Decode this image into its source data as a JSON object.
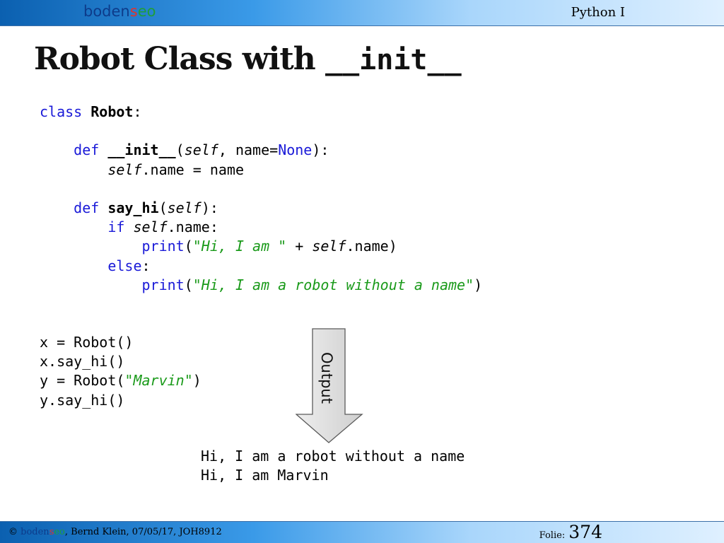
{
  "header": {
    "brand": {
      "part1": "boden",
      "part2": "s",
      "part3": "eo"
    },
    "course": "Python I"
  },
  "slide": {
    "title": {
      "text": "Robot Class with",
      "code": "__init__"
    }
  },
  "code": {
    "line1": {
      "kw": "class",
      "name": "Robot",
      "punct": ":"
    },
    "line3": {
      "kw": "def",
      "name": "__init__",
      "p1": "(",
      "self": "self",
      "rest": ", name=",
      "none": "None",
      "end": "):"
    },
    "line4": {
      "self": "self",
      "rest": ".name = name"
    },
    "line6": {
      "kw": "def",
      "name": "say_hi",
      "p1": "(",
      "self": "self",
      "end": "):"
    },
    "line7": {
      "kw": "if",
      "self": "self",
      "rest": ".name:"
    },
    "line8": {
      "kw": "print",
      "p1": "(",
      "str": "\"Hi, I am \"",
      "mid": " + ",
      "self": "self",
      "end": ".name)"
    },
    "line9": {
      "kw": "else",
      "punct": ":"
    },
    "line10": {
      "kw": "print",
      "p1": "(",
      "str": "\"Hi, I am a robot without a name\"",
      "end": ")"
    }
  },
  "usage": {
    "line1": "x = Robot()",
    "line2": "x.say_hi()",
    "line3a": "y = Robot(",
    "line3str": "\"Marvin\"",
    "line3b": ")",
    "line4": "y.say_hi()"
  },
  "arrow": {
    "label": "Output"
  },
  "output": {
    "line1": "Hi, I am a robot without a name",
    "line2": "Hi, I am Marvin"
  },
  "footer": {
    "copyright": "©",
    "brand": {
      "part1": "boden",
      "part2": "s",
      "part3": "eo"
    },
    "info": ", Bernd Klein, 07/05/17, JOH8912",
    "folie_label": "Folie:",
    "page_number": "374"
  },
  "colors": {
    "keyword": "#1a1ad8",
    "string": "#1a9a1a",
    "bar_dark": "#0b60b0",
    "bar_light": "#dff0ff"
  }
}
